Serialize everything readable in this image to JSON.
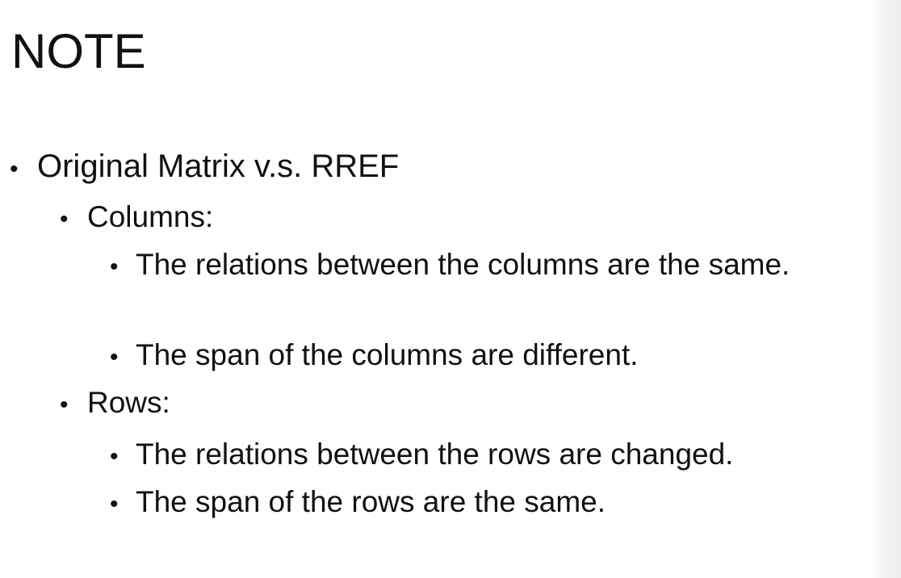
{
  "slide": {
    "title": "NOTE",
    "bullet_symbol": "•",
    "bullets": [
      {
        "level": 1,
        "text": "Original Matrix v.s. RREF"
      },
      {
        "level": 2,
        "text": "Columns:"
      },
      {
        "level": 3,
        "text": "The relations between the columns are the same."
      },
      {
        "level": 3,
        "text": "The span of the columns are different."
      },
      {
        "level": 2,
        "text": "Rows:"
      },
      {
        "level": 3,
        "text": "The relations between the rows are changed."
      },
      {
        "level": 3,
        "text": "The span of the rows are the same."
      }
    ]
  }
}
